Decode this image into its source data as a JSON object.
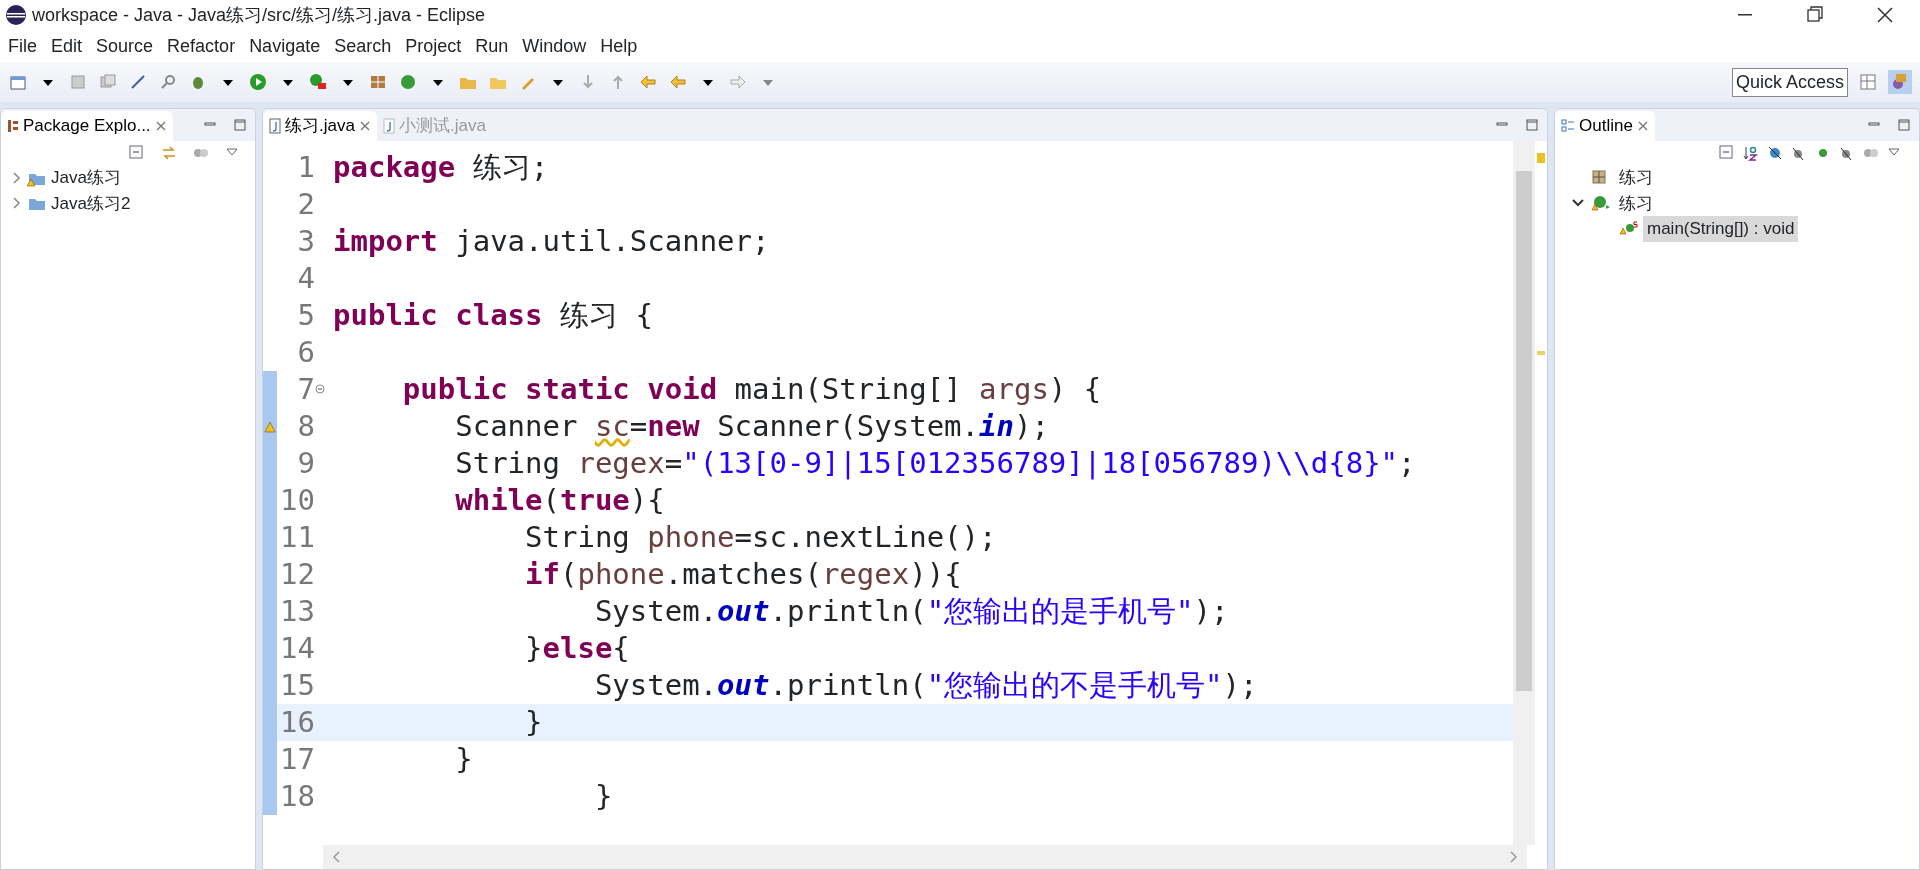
{
  "window": {
    "title": "workspace - Java - Java练习/src/练习/练习.java - Eclipse"
  },
  "menu": [
    "File",
    "Edit",
    "Source",
    "Refactor",
    "Navigate",
    "Search",
    "Project",
    "Run",
    "Window",
    "Help"
  ],
  "quick_access": {
    "label": "Quick Access"
  },
  "package_explorer": {
    "title": "Package Explo...",
    "items": [
      {
        "label": "Java练习",
        "expanded": false,
        "warning": true
      },
      {
        "label": "Java练习2",
        "expanded": false,
        "warning": false
      }
    ]
  },
  "editor": {
    "tabs": [
      {
        "label": "练习.java",
        "selected": true
      },
      {
        "label": "小测试.java",
        "selected": false
      }
    ],
    "lines": [
      {
        "number": "1",
        "current": false,
        "changed": false,
        "warning": false,
        "fold": false,
        "tokens": [
          {
            "kind": "kw",
            "text": "package"
          },
          {
            "kind": "plain",
            "text": " 练习;"
          }
        ]
      },
      {
        "number": "2",
        "current": false,
        "changed": false,
        "warning": false,
        "fold": false
      },
      {
        "number": "3",
        "current": false,
        "changed": false,
        "warning": false,
        "fold": false,
        "tokens": [
          {
            "kind": "kw",
            "text": "import"
          },
          {
            "kind": "plain",
            "text": " java.util.Scanner;"
          }
        ]
      },
      {
        "number": "4",
        "current": false,
        "changed": false,
        "warning": false,
        "fold": false
      },
      {
        "number": "5",
        "current": false,
        "changed": false,
        "warning": false,
        "fold": false,
        "tokens": [
          {
            "kind": "kw",
            "text": "public class"
          },
          {
            "kind": "plain",
            "text": " 练习 {"
          }
        ]
      },
      {
        "number": "6",
        "current": false,
        "changed": false,
        "warning": false,
        "fold": false
      },
      {
        "number": "7",
        "current": false,
        "changed": true,
        "warning": false,
        "fold": true,
        "tokens": [
          {
            "kind": "kw",
            "text": "    public static void"
          },
          {
            "kind": "plain",
            "text": " main(String[] "
          },
          {
            "kind": "var",
            "text": "args"
          },
          {
            "kind": "plain",
            "text": ") {"
          }
        ]
      },
      {
        "number": "8",
        "current": false,
        "changed": true,
        "warning": true,
        "fold": false,
        "tokens": [
          {
            "kind": "plain",
            "text": "       Scanner "
          },
          {
            "kind": "var",
            "text": "sc",
            "warning": true
          },
          {
            "kind": "plain",
            "text": "="
          },
          {
            "kind": "kw",
            "text": "new"
          },
          {
            "kind": "plain",
            "text": " Scanner(System."
          },
          {
            "kind": "field",
            "text": "in"
          },
          {
            "kind": "plain",
            "text": ");"
          }
        ]
      },
      {
        "number": "9",
        "current": false,
        "changed": true,
        "warning": false,
        "fold": false,
        "tokens": [
          {
            "kind": "plain",
            "text": "       String "
          },
          {
            "kind": "var",
            "text": "regex"
          },
          {
            "kind": "plain",
            "text": "="
          },
          {
            "kind": "str",
            "text": "\"(13[0-9]|15[012356789]|18[056789)\\\\d{8}\""
          },
          {
            "kind": "plain",
            "text": ";"
          }
        ]
      },
      {
        "number": "10",
        "current": false,
        "changed": true,
        "warning": false,
        "fold": false,
        "tokens": [
          {
            "kind": "kw",
            "text": "       while"
          },
          {
            "kind": "plain",
            "text": "("
          },
          {
            "kind": "kw",
            "text": "true"
          },
          {
            "kind": "plain",
            "text": "){"
          }
        ]
      },
      {
        "number": "11",
        "current": false,
        "changed": true,
        "warning": false,
        "fold": false,
        "tokens": [
          {
            "kind": "plain",
            "text": "           String "
          },
          {
            "kind": "var",
            "text": "phone"
          },
          {
            "kind": "plain",
            "text": "=sc.nextLine();"
          }
        ]
      },
      {
        "number": "12",
        "current": false,
        "changed": true,
        "warning": false,
        "fold": false,
        "tokens": [
          {
            "kind": "kw",
            "text": "           if"
          },
          {
            "kind": "plain",
            "text": "("
          },
          {
            "kind": "var",
            "text": "phone"
          },
          {
            "kind": "plain",
            "text": ".matches("
          },
          {
            "kind": "var",
            "text": "regex"
          },
          {
            "kind": "plain",
            "text": ")){"
          }
        ]
      },
      {
        "number": "13",
        "current": false,
        "changed": true,
        "warning": false,
        "fold": false,
        "tokens": [
          {
            "kind": "plain",
            "text": "               System."
          },
          {
            "kind": "field",
            "text": "out"
          },
          {
            "kind": "plain",
            "text": ".println("
          },
          {
            "kind": "str",
            "text": "\"您输出的是手机号\""
          },
          {
            "kind": "plain",
            "text": ");"
          }
        ]
      },
      {
        "number": "14",
        "current": false,
        "changed": true,
        "warning": false,
        "fold": false,
        "tokens": [
          {
            "kind": "plain",
            "text": "           }"
          },
          {
            "kind": "kw",
            "text": "else"
          },
          {
            "kind": "plain",
            "text": "{"
          }
        ]
      },
      {
        "number": "15",
        "current": false,
        "changed": true,
        "warning": false,
        "fold": false,
        "tokens": [
          {
            "kind": "plain",
            "text": "               System."
          },
          {
            "kind": "field",
            "text": "out"
          },
          {
            "kind": "plain",
            "text": ".println("
          },
          {
            "kind": "str",
            "text": "\"您输出的不是手机号\""
          },
          {
            "kind": "plain",
            "text": ");"
          }
        ]
      },
      {
        "number": "16",
        "current": true,
        "changed": true,
        "warning": false,
        "fold": false,
        "tokens": [
          {
            "kind": "plain",
            "text": "           }"
          }
        ]
      },
      {
        "number": "17",
        "current": false,
        "changed": true,
        "warning": false,
        "fold": false,
        "tokens": [
          {
            "kind": "plain",
            "text": "       }"
          }
        ]
      },
      {
        "number": "18",
        "current": false,
        "changed": true,
        "warning": false,
        "fold": false,
        "tokens": [
          {
            "kind": "plain",
            "text": "               }"
          }
        ]
      }
    ]
  },
  "outline": {
    "title": "Outline",
    "items": [
      {
        "label": "练习",
        "kind": "package",
        "selected": false
      },
      {
        "label": "练习",
        "kind": "class",
        "expanded": true,
        "selected": false,
        "children": [
          {
            "label": "main(String[]) : void",
            "kind": "method",
            "selected": true
          }
        ]
      }
    ]
  }
}
